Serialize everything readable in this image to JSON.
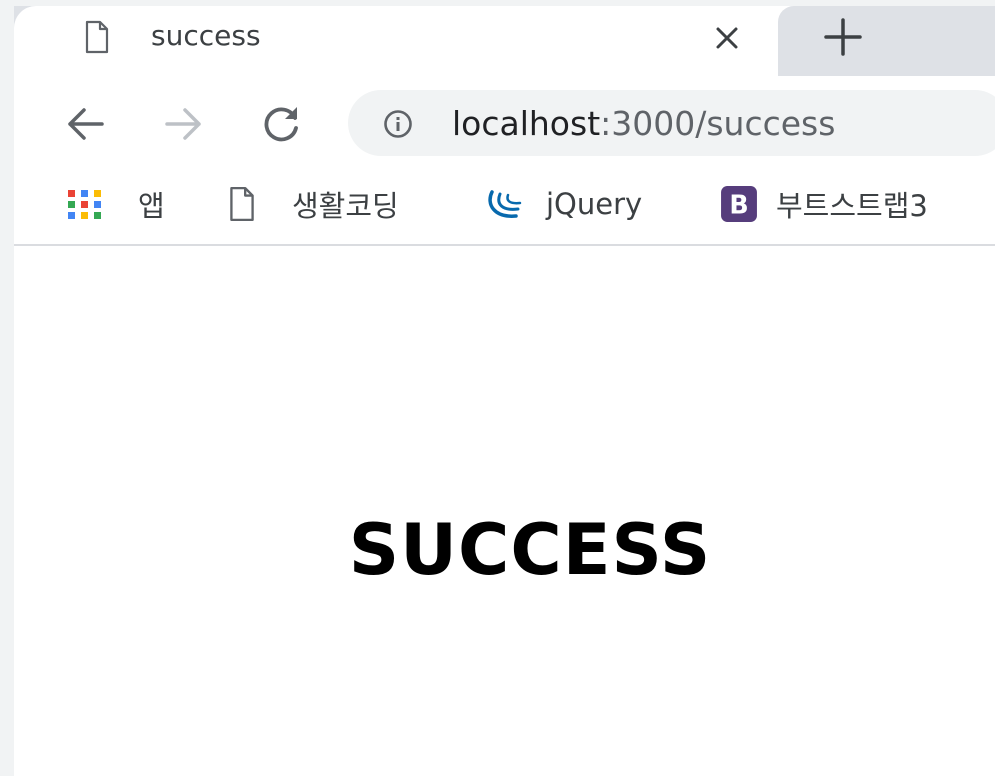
{
  "browser": {
    "tab": {
      "title": "success",
      "favicon": "page-icon",
      "close_glyph": "×"
    },
    "new_tab_glyph": "+",
    "nav": {
      "back_icon": "arrow-left-icon",
      "forward_icon": "arrow-right-icon",
      "reload_icon": "reload-icon"
    },
    "address": {
      "host": "localhost",
      "rest": ":3000/success",
      "info_icon": "info-icon"
    },
    "bookmarks": [
      {
        "label": "앱",
        "icon": "apps-grid-icon"
      },
      {
        "label": "생활코딩",
        "icon": "page-icon"
      },
      {
        "label": "jQuery",
        "icon": "jquery-icon"
      },
      {
        "label": "부트스트랩3",
        "icon": "bootstrap-icon"
      }
    ]
  },
  "page": {
    "heading": "SUCCESS"
  },
  "colors": {
    "chrome_bg": "#dee1e6",
    "omnibox_bg": "#f1f3f4",
    "bootstrap_purple": "#563d7c",
    "jquery_blue": "#0769ad"
  }
}
